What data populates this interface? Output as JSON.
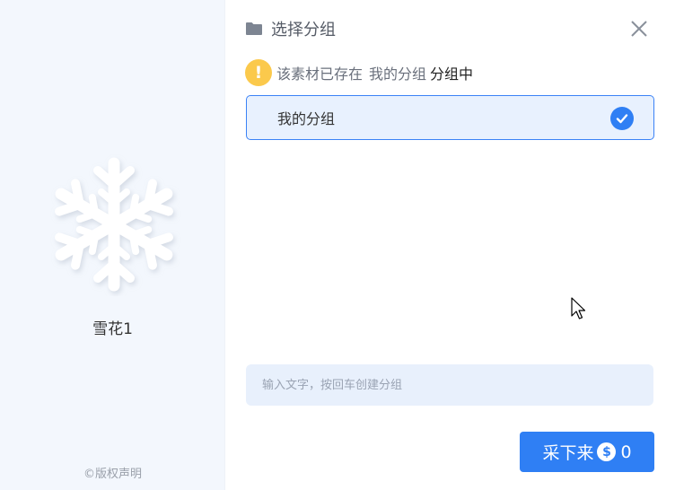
{
  "header": {
    "title": "选择分组",
    "icon": "folder-icon",
    "close_icon": "close-icon"
  },
  "notice": {
    "icon": "!",
    "text_prefix": "该素材已存在",
    "group_name": "我的分组",
    "text_suffix": "分组中"
  },
  "groups": [
    {
      "label": "我的分组",
      "selected": true
    }
  ],
  "new_group": {
    "value": "",
    "placeholder": "输入文字，按回车创建分组"
  },
  "collect_button": {
    "label": "采下来",
    "coin_icon": "$",
    "cost": "0"
  },
  "preview": {
    "name": "雪花1",
    "copyright": "©版权声明"
  },
  "colors": {
    "accent": "#2f7ff4",
    "warning": "#fbc94c",
    "selected_bg": "#e8f1fe",
    "sidebar_bg": "#f3f7fd"
  }
}
